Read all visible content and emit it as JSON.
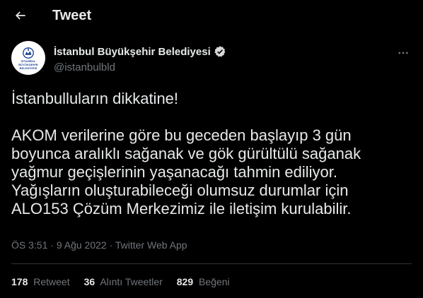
{
  "header": {
    "title": "Tweet"
  },
  "author": {
    "name": "İstanbul Büyükşehir Belediyesi",
    "handle": "@istanbulbld",
    "avatar_text": "İSTANBUL BÜYÜKŞEHİR BELEDİYESİ"
  },
  "tweet": {
    "line1": "İstanbulluların dikkatine!",
    "line2": "AKOM verilerine göre bu geceden başlayıp 3 gün",
    "line3": "boyunca aralıklı sağanak ve gök gürültülü sağanak",
    "line4": "yağmur geçişlerinin yaşanacağı tahmin ediliyor.",
    "line5": "Yağışların oluşturabileceği olumsuz durumlar için",
    "line6": "ALO153 Çözüm Merkezimiz ile iletişim kurulabilir."
  },
  "meta": {
    "time": "ÖS 3:51",
    "sep1": "·",
    "date": "9 Ağu 2022",
    "sep2": "·",
    "source": "Twitter Web App"
  },
  "stats": {
    "retweets_count": "178",
    "retweets_label": "Retweet",
    "quotes_count": "36",
    "quotes_label": "Alıntı Tweetler",
    "likes_count": "829",
    "likes_label": "Beğeni"
  },
  "colors": {
    "background": "#000000",
    "text": "#e7e9ea",
    "muted": "#71767b",
    "verified": "#d9d9d9"
  }
}
